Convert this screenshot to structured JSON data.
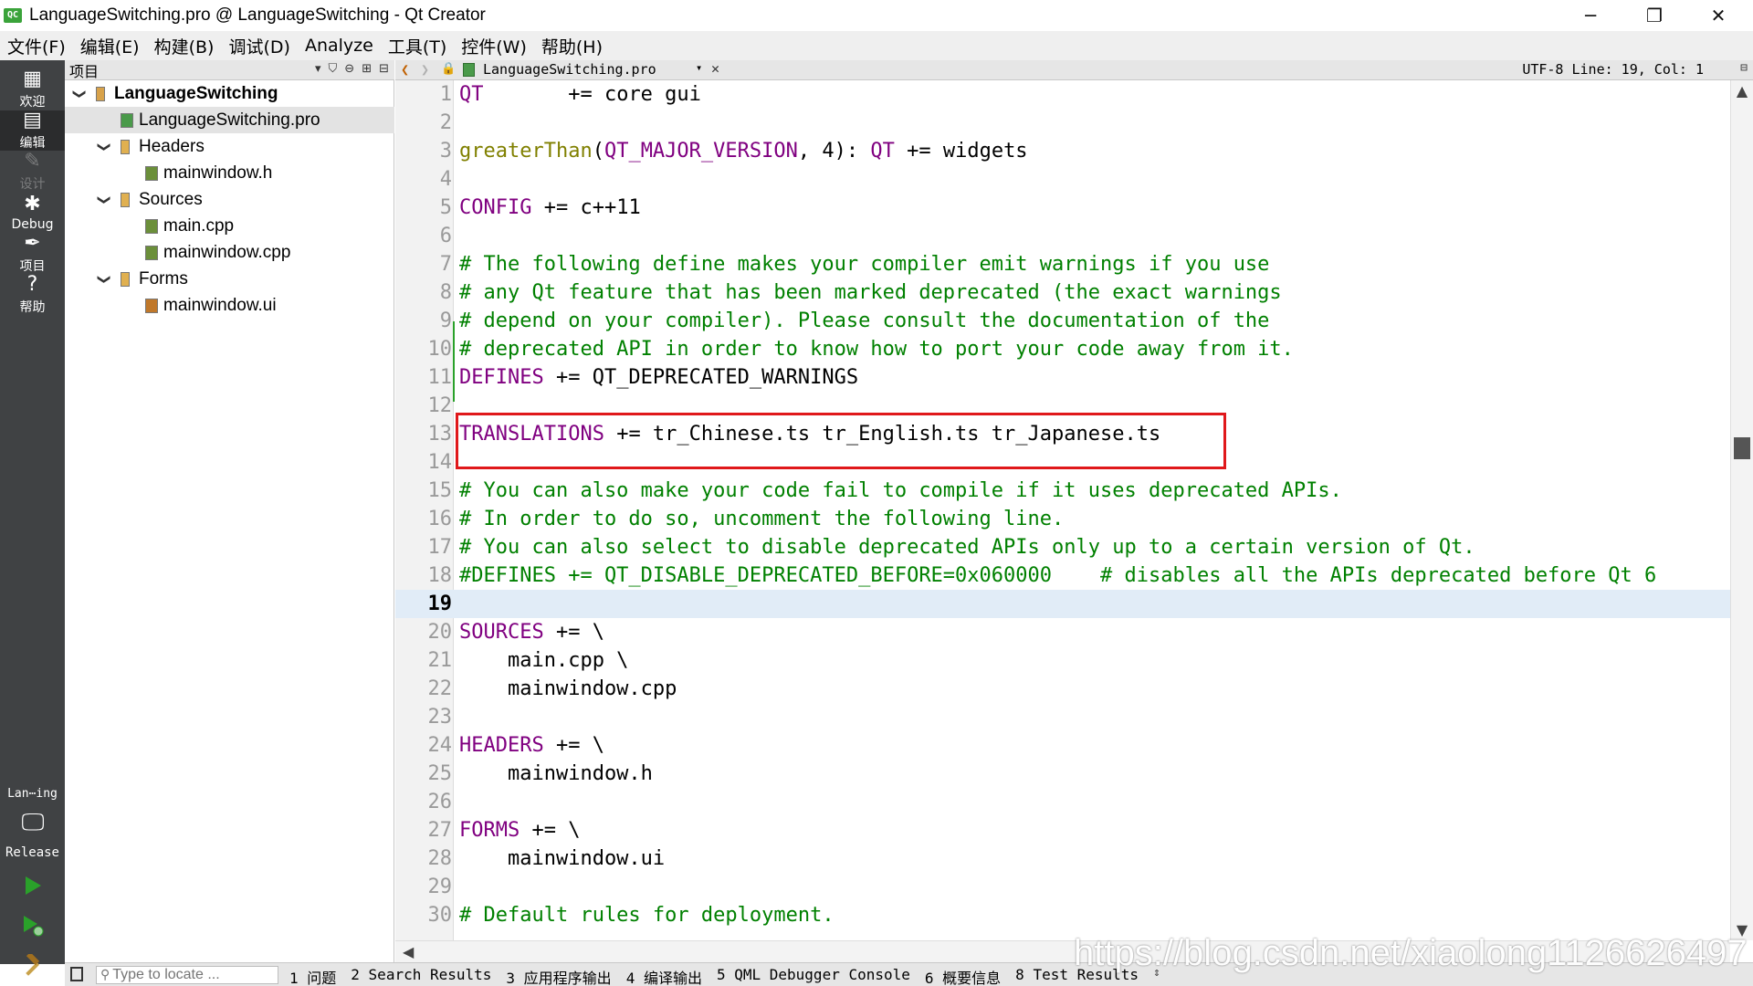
{
  "window": {
    "title": "LanguageSwitching.pro @ LanguageSwitching - Qt Creator",
    "app_icon_text": "QC",
    "minimize": "─",
    "restore": "❐",
    "close": "✕"
  },
  "menu": [
    "文件(F)",
    "编辑(E)",
    "构建(B)",
    "调试(D)",
    "Analyze",
    "工具(T)",
    "控件(W)",
    "帮助(H)"
  ],
  "modes": [
    {
      "label": "欢迎",
      "icon": "grid-icon",
      "glyph": "▦",
      "active": false,
      "disabled": false
    },
    {
      "label": "编辑",
      "icon": "document-icon",
      "glyph": "▤",
      "active": true,
      "disabled": false
    },
    {
      "label": "设计",
      "icon": "pencil-icon",
      "glyph": "✎",
      "active": false,
      "disabled": true
    },
    {
      "label": "Debug",
      "icon": "bug-icon",
      "glyph": "✱",
      "active": false,
      "disabled": false
    },
    {
      "label": "项目",
      "icon": "wrench-icon",
      "glyph": "✒",
      "active": false,
      "disabled": false
    },
    {
      "label": "帮助",
      "icon": "help-icon",
      "glyph": "?",
      "active": false,
      "disabled": false
    }
  ],
  "kit": {
    "name": "Lan⋯ing",
    "build": "Release",
    "monitor_glyph": "🖵"
  },
  "project_panel": {
    "title": "项目",
    "tools": [
      "▾",
      "⛉",
      "⊖",
      "⊞",
      "⊟"
    ],
    "tree": [
      {
        "label": "LanguageSwitching",
        "level": 0,
        "expanded": true,
        "type": "project",
        "bold": true,
        "selected": false
      },
      {
        "label": "LanguageSwitching.pro",
        "level": 1,
        "expanded": null,
        "type": "pro",
        "bold": false,
        "selected": true
      },
      {
        "label": "Headers",
        "level": 1,
        "expanded": true,
        "type": "folder",
        "bold": false,
        "selected": false
      },
      {
        "label": "mainwindow.h",
        "level": 2,
        "expanded": null,
        "type": "header",
        "bold": false,
        "selected": false
      },
      {
        "label": "Sources",
        "level": 1,
        "expanded": true,
        "type": "folder",
        "bold": false,
        "selected": false
      },
      {
        "label": "main.cpp",
        "level": 2,
        "expanded": null,
        "type": "source",
        "bold": false,
        "selected": false
      },
      {
        "label": "mainwindow.cpp",
        "level": 2,
        "expanded": null,
        "type": "source",
        "bold": false,
        "selected": false
      },
      {
        "label": "Forms",
        "level": 1,
        "expanded": true,
        "type": "folder",
        "bold": false,
        "selected": false
      },
      {
        "label": "mainwindow.ui",
        "level": 2,
        "expanded": null,
        "type": "form",
        "bold": false,
        "selected": false
      }
    ]
  },
  "editor_toolbar": {
    "back": "❮",
    "forward": "❯",
    "lock": "🔒",
    "file": "LanguageSwitching.pro",
    "combo_arrow": "▾",
    "close": "✕",
    "status": "UTF-8 Line: 19, Col: 1",
    "split": "⊟"
  },
  "editor": {
    "current_line": 19,
    "lines": [
      [
        {
          "t": "QT",
          "c": "kw"
        },
        {
          "t": "       += core gui",
          "c": ""
        }
      ],
      [],
      [
        {
          "t": "greaterThan",
          "c": "fn"
        },
        {
          "t": "(",
          "c": ""
        },
        {
          "t": "QT_MAJOR_VERSION",
          "c": "kw"
        },
        {
          "t": ", 4): ",
          "c": ""
        },
        {
          "t": "QT",
          "c": "kw"
        },
        {
          "t": " += widgets",
          "c": ""
        }
      ],
      [],
      [
        {
          "t": "CONFIG",
          "c": "kw"
        },
        {
          "t": " += c++11",
          "c": ""
        }
      ],
      [],
      [
        {
          "t": "# The following define makes your compiler emit warnings if you use",
          "c": "cm"
        }
      ],
      [
        {
          "t": "# any Qt feature that has been marked deprecated (the exact warnings",
          "c": "cm"
        }
      ],
      [
        {
          "t": "# depend on your compiler). Please consult the documentation of the",
          "c": "cm"
        }
      ],
      [
        {
          "t": "# deprecated API in order to know how to port your code away from it.",
          "c": "cm"
        }
      ],
      [
        {
          "t": "DEFINES",
          "c": "kw"
        },
        {
          "t": " += QT_DEPRECATED_WARNINGS",
          "c": ""
        }
      ],
      [],
      [
        {
          "t": "TRANSLATIONS",
          "c": "kw"
        },
        {
          "t": " += tr_Chinese.ts tr_English.ts tr_Japanese.ts",
          "c": ""
        }
      ],
      [],
      [
        {
          "t": "# You can also make your code fail to compile if it uses deprecated APIs.",
          "c": "cm"
        }
      ],
      [
        {
          "t": "# In order to do so, uncomment the following line.",
          "c": "cm"
        }
      ],
      [
        {
          "t": "# You can also select to disable deprecated APIs only up to a certain version of Qt.",
          "c": "cm"
        }
      ],
      [
        {
          "t": "#DEFINES += QT_DISABLE_DEPRECATED_BEFORE=0x060000    # disables all the APIs deprecated before Qt 6",
          "c": "cm"
        }
      ],
      [],
      [
        {
          "t": "SOURCES",
          "c": "kw"
        },
        {
          "t": " += \\",
          "c": ""
        }
      ],
      [
        {
          "t": "    main.cpp \\",
          "c": ""
        }
      ],
      [
        {
          "t": "    mainwindow.cpp",
          "c": ""
        }
      ],
      [],
      [
        {
          "t": "HEADERS",
          "c": "kw"
        },
        {
          "t": " += \\",
          "c": ""
        }
      ],
      [
        {
          "t": "    mainwindow.h",
          "c": ""
        }
      ],
      [],
      [
        {
          "t": "FORMS",
          "c": "kw"
        },
        {
          "t": " += \\",
          "c": ""
        }
      ],
      [
        {
          "t": "    mainwindow.ui",
          "c": ""
        }
      ],
      [],
      [
        {
          "t": "# Default rules for deployment.",
          "c": "cm"
        }
      ]
    ]
  },
  "scrollbar": {
    "up": "▲",
    "down": "▼",
    "left": "◀",
    "position_fraction": 0.41
  },
  "bottom": {
    "locator_placeholder": "Type to locate ...",
    "locator_icon": "⚲",
    "tabs": [
      "1 问题",
      "2 Search Results",
      "3 应用程序输出",
      "4 编译输出",
      "5 QML Debugger Console",
      "6 概要信息",
      "8 Test Results"
    ],
    "tabs_arrows": "⇕"
  },
  "watermark": "https://blog.csdn.net/xiaolong1126626497",
  "colors": {
    "keyword": "#800080",
    "function": "#808000",
    "comment": "#008000",
    "highlight_box": "#e0181b",
    "current_line": "#e1ecf7",
    "mode_bar": "#404244",
    "run_green": "#2aa12a"
  }
}
